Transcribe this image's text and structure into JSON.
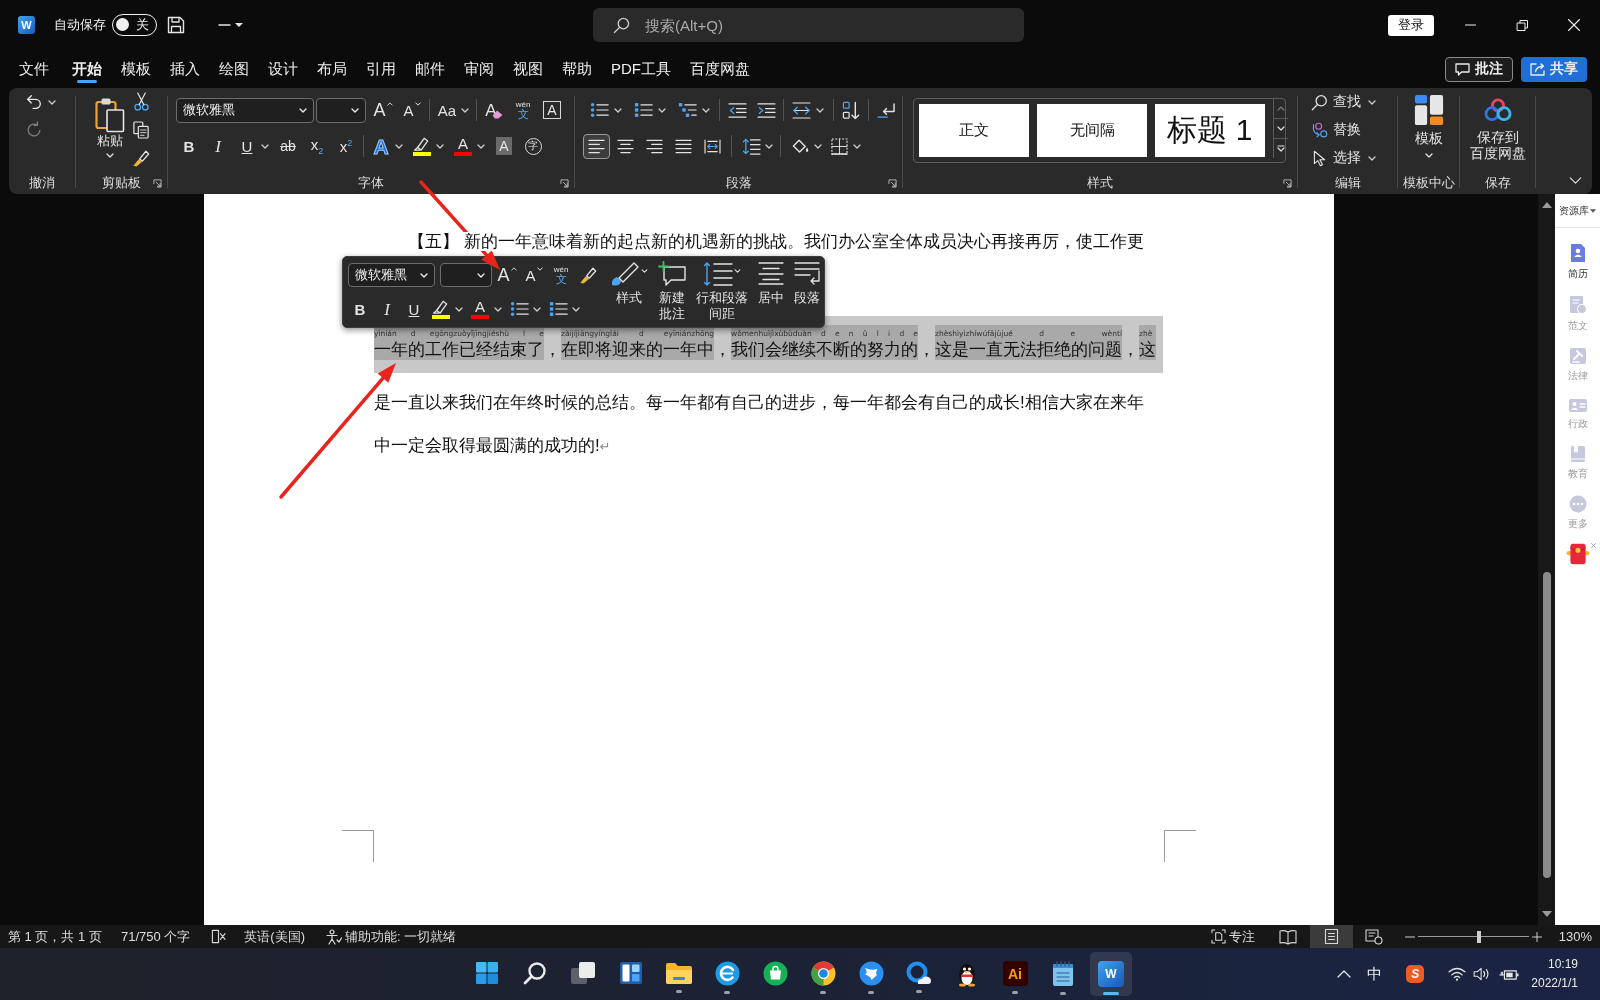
{
  "title_bar": {
    "app_letter": "W",
    "autosave_label": "自动保存",
    "autosave": {
      "on": false,
      "label": "关"
    },
    "search": {
      "placeholder": "搜索(Alt+Q)"
    },
    "login": "登录"
  },
  "menu_tabs": [
    {
      "label": "文件",
      "selected": false
    },
    {
      "label": "开始",
      "selected": true
    },
    {
      "label": "模板",
      "selected": false
    },
    {
      "label": "插入",
      "selected": false
    },
    {
      "label": "绘图",
      "selected": false
    },
    {
      "label": "设计",
      "selected": false
    },
    {
      "label": "布局",
      "selected": false
    },
    {
      "label": "引用",
      "selected": false
    },
    {
      "label": "邮件",
      "selected": false
    },
    {
      "label": "审阅",
      "selected": false
    },
    {
      "label": "视图",
      "selected": false
    },
    {
      "label": "帮助",
      "selected": false
    },
    {
      "label": "PDF工具",
      "selected": false
    },
    {
      "label": "百度网盘",
      "selected": false
    }
  ],
  "menu_actions": [
    {
      "kind": "comment",
      "label": "批注"
    },
    {
      "kind": "share",
      "label": "共享"
    }
  ],
  "ribbon": {
    "undo": {
      "label": "撤消",
      "redo": {
        "disabled": true
      }
    },
    "clipboard": {
      "label": "剪贴板",
      "paste": "粘贴"
    },
    "font": {
      "label": "字体",
      "font_name": "微软雅黑",
      "row1": [
        {
          "kind": "grow",
          "label": "A",
          "dropdown": false
        },
        {
          "kind": "shrink",
          "label": "A",
          "dropdown": false
        },
        {
          "kind": "case",
          "label": "Aa",
          "dropdown": true
        },
        {
          "kind": "clear",
          "label": "A",
          "dropdown": false
        },
        {
          "kind": "phonetic",
          "ruby": "wén",
          "label": "文",
          "dropdown": false
        },
        {
          "kind": "border",
          "label": "A",
          "dropdown": false
        }
      ],
      "row2": [
        {
          "kind": "bold",
          "label": "B",
          "dropdown": false
        },
        {
          "kind": "italic",
          "label": "I",
          "dropdown": false
        },
        {
          "kind": "underline",
          "label": "U",
          "dropdown": true
        },
        {
          "kind": "strike",
          "label": "ab",
          "dropdown": false
        },
        {
          "kind": "sub",
          "label": "x$_{2}$",
          "dropdown": false
        },
        {
          "kind": "sup",
          "label": "x$^{2}$",
          "dropdown": false
        },
        {
          "kind": "effects",
          "label": "A",
          "dropdown": true
        },
        {
          "kind": "highlight",
          "color": "#ffff00",
          "dropdown": true
        },
        {
          "kind": "font-color",
          "label": "A",
          "color": "#ff0000",
          "dropdown": true
        },
        {
          "kind": "shade",
          "label": "A",
          "dropdown": false
        },
        {
          "kind": "enclose",
          "label": "字",
          "dropdown": false
        }
      ]
    },
    "paragraph": {
      "label": "段落",
      "row1": [
        {
          "kind": "bullets",
          "dropdown": true
        },
        {
          "kind": "numbering",
          "dropdown": true
        },
        {
          "kind": "multilevel",
          "dropdown": true
        },
        {
          "kind": "outdent",
          "dropdown": false
        },
        {
          "kind": "indent",
          "dropdown": false
        },
        {
          "kind": "asian",
          "dropdown": true
        },
        {
          "kind": "sort",
          "dropdown": false
        },
        {
          "kind": "marks",
          "dropdown": false
        }
      ],
      "alignment": [
        {
          "kind": "align-left",
          "selected": true
        },
        {
          "kind": "align-center",
          "selected": false
        },
        {
          "kind": "align-right",
          "selected": false
        },
        {
          "kind": "justify",
          "selected": false
        },
        {
          "kind": "distributed",
          "selected": false
        }
      ],
      "tools": [
        {
          "kind": "line-spacing",
          "dropdown": true
        },
        {
          "kind": "shading",
          "dropdown": true
        },
        {
          "kind": "borders",
          "dropdown": true
        }
      ]
    },
    "styles": {
      "label": "样式",
      "items": [
        {
          "kind": "normal",
          "label": "正文"
        },
        {
          "kind": "normal",
          "label": "无间隔"
        },
        {
          "kind": "heading",
          "label": "标题 1"
        }
      ]
    },
    "editing": {
      "label": "编辑",
      "items": [
        {
          "kind": "find",
          "label": "查找",
          "dropdown": true
        },
        {
          "kind": "replace",
          "label": "替换",
          "dropdown": false
        },
        {
          "kind": "select",
          "label": "选择",
          "dropdown": true
        }
      ]
    },
    "templates": {
      "label": "模板中心",
      "button": "模板"
    },
    "save": {
      "label": "保存",
      "button_lines": [
        "保存到",
        "百度网盘"
      ]
    }
  },
  "document": {
    "lines": [
      {
        "kind": "indented",
        "text": "【五】 新的一年意味着新的起点新的机遇新的挑战。我们办公室全体成员决心再接再厉，使工作更"
      },
      {
        "kind": "phonetic",
        "selected": true,
        "segments": [
          {
            "pinyin": "yìnián d egōngzuòyǐjīngjiéshù l e",
            "text": "一年的工作已经结束了"
          },
          {
            "text": "，"
          },
          {
            "pinyin": "zàijíjiāngyínglái d eyīniánzhōng",
            "text": "在即将迎来的一年中"
          },
          {
            "text": "，"
          },
          {
            "pinyin": "wǒmenhuìjìxùbùduàn d e n ǔ l i d e",
            "text": "我们会继续不断的努力的"
          },
          {
            "text": "，"
          },
          {
            "pinyin": "zhèshìyìzhíwúfǎjùjué d e wèntí",
            "text": "这是一直无法拒绝的问题"
          },
          {
            "text": "，"
          },
          {
            "pinyin": "zhè",
            "text": "这"
          }
        ]
      },
      {
        "kind": "plain",
        "text": "是一直以来我们在年终时候的总结。每一年都有自己的进步，每一年都会有自己的成长!相信大家在来年"
      },
      {
        "kind": "plain",
        "text": "中一定会取得最圆满的成功的!",
        "mark": "↵"
      }
    ]
  },
  "mini_toolbar": {
    "font_name": "微软雅黑",
    "row1": [
      {
        "kind": "grow",
        "label": "A",
        "dropdown": false
      },
      {
        "kind": "shrink",
        "label": "A",
        "dropdown": false
      },
      {
        "kind": "phonetic",
        "ruby": "wén",
        "label": "文",
        "dropdown": false
      },
      {
        "kind": "painter",
        "dropdown": false
      }
    ],
    "row2": [
      {
        "kind": "bold",
        "label": "B",
        "dropdown": false
      },
      {
        "kind": "italic",
        "label": "I",
        "dropdown": false
      },
      {
        "kind": "underline",
        "label": "U",
        "dropdown": false
      },
      {
        "kind": "highlight",
        "color": "#ffff00",
        "dropdown": true
      },
      {
        "kind": "font-color",
        "label": "A",
        "color": "#ff0000",
        "dropdown": true
      },
      {
        "kind": "bullets",
        "dropdown": true
      },
      {
        "kind": "numbering",
        "dropdown": true
      }
    ],
    "big": [
      {
        "kind": "styles",
        "lines": [
          "样式"
        ],
        "dropdown": true
      },
      {
        "kind": "new-comment",
        "lines": [
          "新建",
          "批注"
        ],
        "dropdown": false
      },
      {
        "kind": "spacing",
        "lines": [
          "行和段落",
          "间距"
        ],
        "dropdown": true
      },
      {
        "kind": "center",
        "lines": [
          "居中"
        ],
        "dropdown": false
      },
      {
        "kind": "paragraph",
        "lines": [
          "段落"
        ],
        "dropdown": false
      }
    ]
  },
  "status_bar": {
    "items": [
      {
        "kind": "text",
        "label": "第 1 页，共 1 页"
      },
      {
        "kind": "text",
        "label": "71/750 个字"
      },
      {
        "kind": "proofing"
      },
      {
        "kind": "text",
        "label": "英语(美国)"
      },
      {
        "kind": "accessibility",
        "label": "辅助功能: 一切就绪"
      }
    ],
    "focus": "专注",
    "views": [
      {
        "kind": "read",
        "selected": false
      },
      {
        "kind": "print",
        "selected": true
      },
      {
        "kind": "web",
        "selected": false
      }
    ],
    "zoom": {
      "level": 0.55,
      "reading": "130%"
    }
  },
  "resource_panel": {
    "title": "资源库",
    "items": [
      {
        "kind": "resume",
        "label": "简历",
        "selected": true
      },
      {
        "kind": "sample",
        "label": "范文",
        "selected": false
      },
      {
        "kind": "law",
        "label": "法律",
        "selected": false
      },
      {
        "kind": "admin",
        "label": "行政",
        "selected": false
      },
      {
        "kind": "education",
        "label": "教育",
        "selected": false
      },
      {
        "kind": "more",
        "label": "更多",
        "selected": false
      }
    ]
  },
  "taskbar": {
    "apps": [
      {
        "kind": "start",
        "running": false,
        "selected": false
      },
      {
        "kind": "search",
        "running": false,
        "selected": false
      },
      {
        "kind": "task-view",
        "running": false,
        "selected": false
      },
      {
        "kind": "widgets",
        "running": false,
        "selected": false
      },
      {
        "kind": "folder",
        "running": true,
        "selected": false
      },
      {
        "kind": "swirl-browser",
        "running": true,
        "selected": false
      },
      {
        "kind": "bag",
        "running": false,
        "selected": false
      },
      {
        "kind": "ball-browser",
        "running": true,
        "selected": false
      },
      {
        "kind": "bird",
        "running": true,
        "selected": false
      },
      {
        "kind": "cloud-browser",
        "running": true,
        "selected": false
      },
      {
        "kind": "penguin",
        "running": false,
        "selected": false
      },
      {
        "kind": "ai",
        "label": "Ai",
        "running": true,
        "selected": false
      },
      {
        "kind": "notepad",
        "running": true,
        "selected": false
      },
      {
        "kind": "word",
        "label": "W",
        "running": true,
        "selected": true
      }
    ],
    "tray": {
      "ime": "中",
      "input_letter": "S",
      "time": "10:19",
      "date": "2022/1/1"
    }
  },
  "annotations": [
    {
      "kind": "arrow"
    },
    {
      "kind": "arrow"
    }
  ]
}
